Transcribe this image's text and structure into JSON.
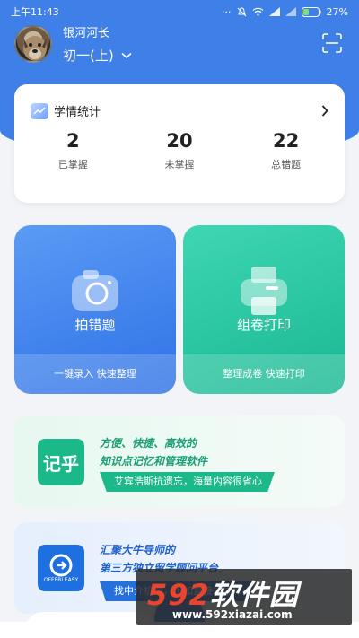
{
  "status_bar": {
    "time": "上午11:43",
    "battery": "27%"
  },
  "profile": {
    "name": "银河河长",
    "grade": "初一(上)"
  },
  "stats_card": {
    "title": "学情统计",
    "stats": [
      {
        "value": "2",
        "label": "已掌握"
      },
      {
        "value": "20",
        "label": "未掌握"
      },
      {
        "value": "22",
        "label": "总错题"
      }
    ]
  },
  "features": [
    {
      "label": "拍错题",
      "sub": "一键录入 快速整理"
    },
    {
      "label": "组卷打印",
      "sub": "整理成卷 快速打印"
    }
  ],
  "banners": [
    {
      "logo_text": "记乎",
      "line1": "方便、快捷、高效的",
      "line2": "知识点记忆和管理软件",
      "pill": "艾宾浩斯抗遗忘，海量内容很省心"
    },
    {
      "logo_text": "OFFERLEASY",
      "line1": "汇聚大牛导师的",
      "line2": "第三方独立留学顾问平台",
      "pill": "找中介机构，不如直接找导师"
    }
  ],
  "watermark": {
    "big_prefix": "592",
    "big_suffix": "软件园",
    "small": "www.592xiazai.com"
  },
  "colors": {
    "primary_blue": "#3f7fe8",
    "teal": "#1bb98a"
  }
}
